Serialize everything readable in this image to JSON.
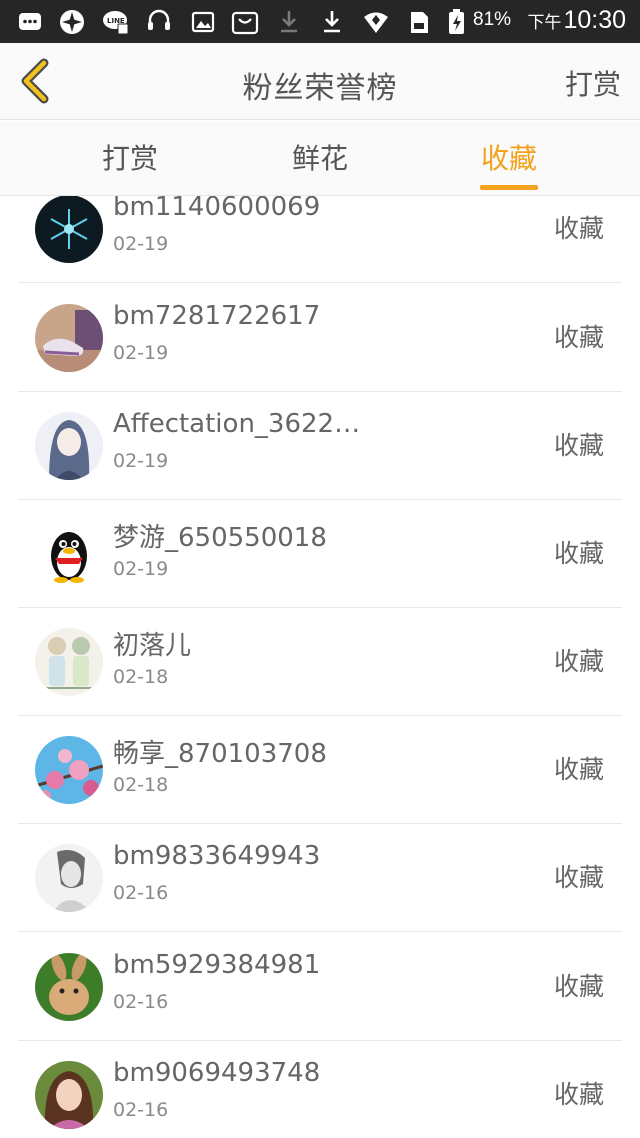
{
  "status_bar": {
    "battery": "81%",
    "time_prefix": "下午",
    "time": "10:30"
  },
  "header": {
    "title": "粉丝荣誉榜",
    "right_link": "打赏",
    "accent": "#f2a21c"
  },
  "tabs": [
    {
      "label": "打赏",
      "active": false
    },
    {
      "label": "鲜花",
      "active": false
    },
    {
      "label": "收藏",
      "active": true
    }
  ],
  "list": [
    {
      "name": "bm1140600069",
      "date": "02-19",
      "action": "收藏",
      "avatar": "snowflake-avatar"
    },
    {
      "name": "bm7281722617",
      "date": "02-19",
      "action": "收藏",
      "avatar": "sneaker-avatar"
    },
    {
      "name": "Affectation_3622…",
      "date": "02-19",
      "action": "收藏",
      "avatar": "anime-girl-avatar"
    },
    {
      "name": "梦游_650550018",
      "date": "02-19",
      "action": "收藏",
      "avatar": "penguin-avatar"
    },
    {
      "name": "初落儿",
      "date": "02-18",
      "action": "收藏",
      "avatar": "sketch-couple-avatar"
    },
    {
      "name": "畅享_870103708",
      "date": "02-18",
      "action": "收藏",
      "avatar": "blossom-avatar"
    },
    {
      "name": "bm9833649943",
      "date": "02-16",
      "action": "收藏",
      "avatar": "grey-anime-avatar"
    },
    {
      "name": "bm5929384981",
      "date": "02-16",
      "action": "收藏",
      "avatar": "rabbit-avatar"
    },
    {
      "name": "bm9069493748",
      "date": "02-16",
      "action": "收藏",
      "avatar": "girl-photo-avatar"
    }
  ]
}
